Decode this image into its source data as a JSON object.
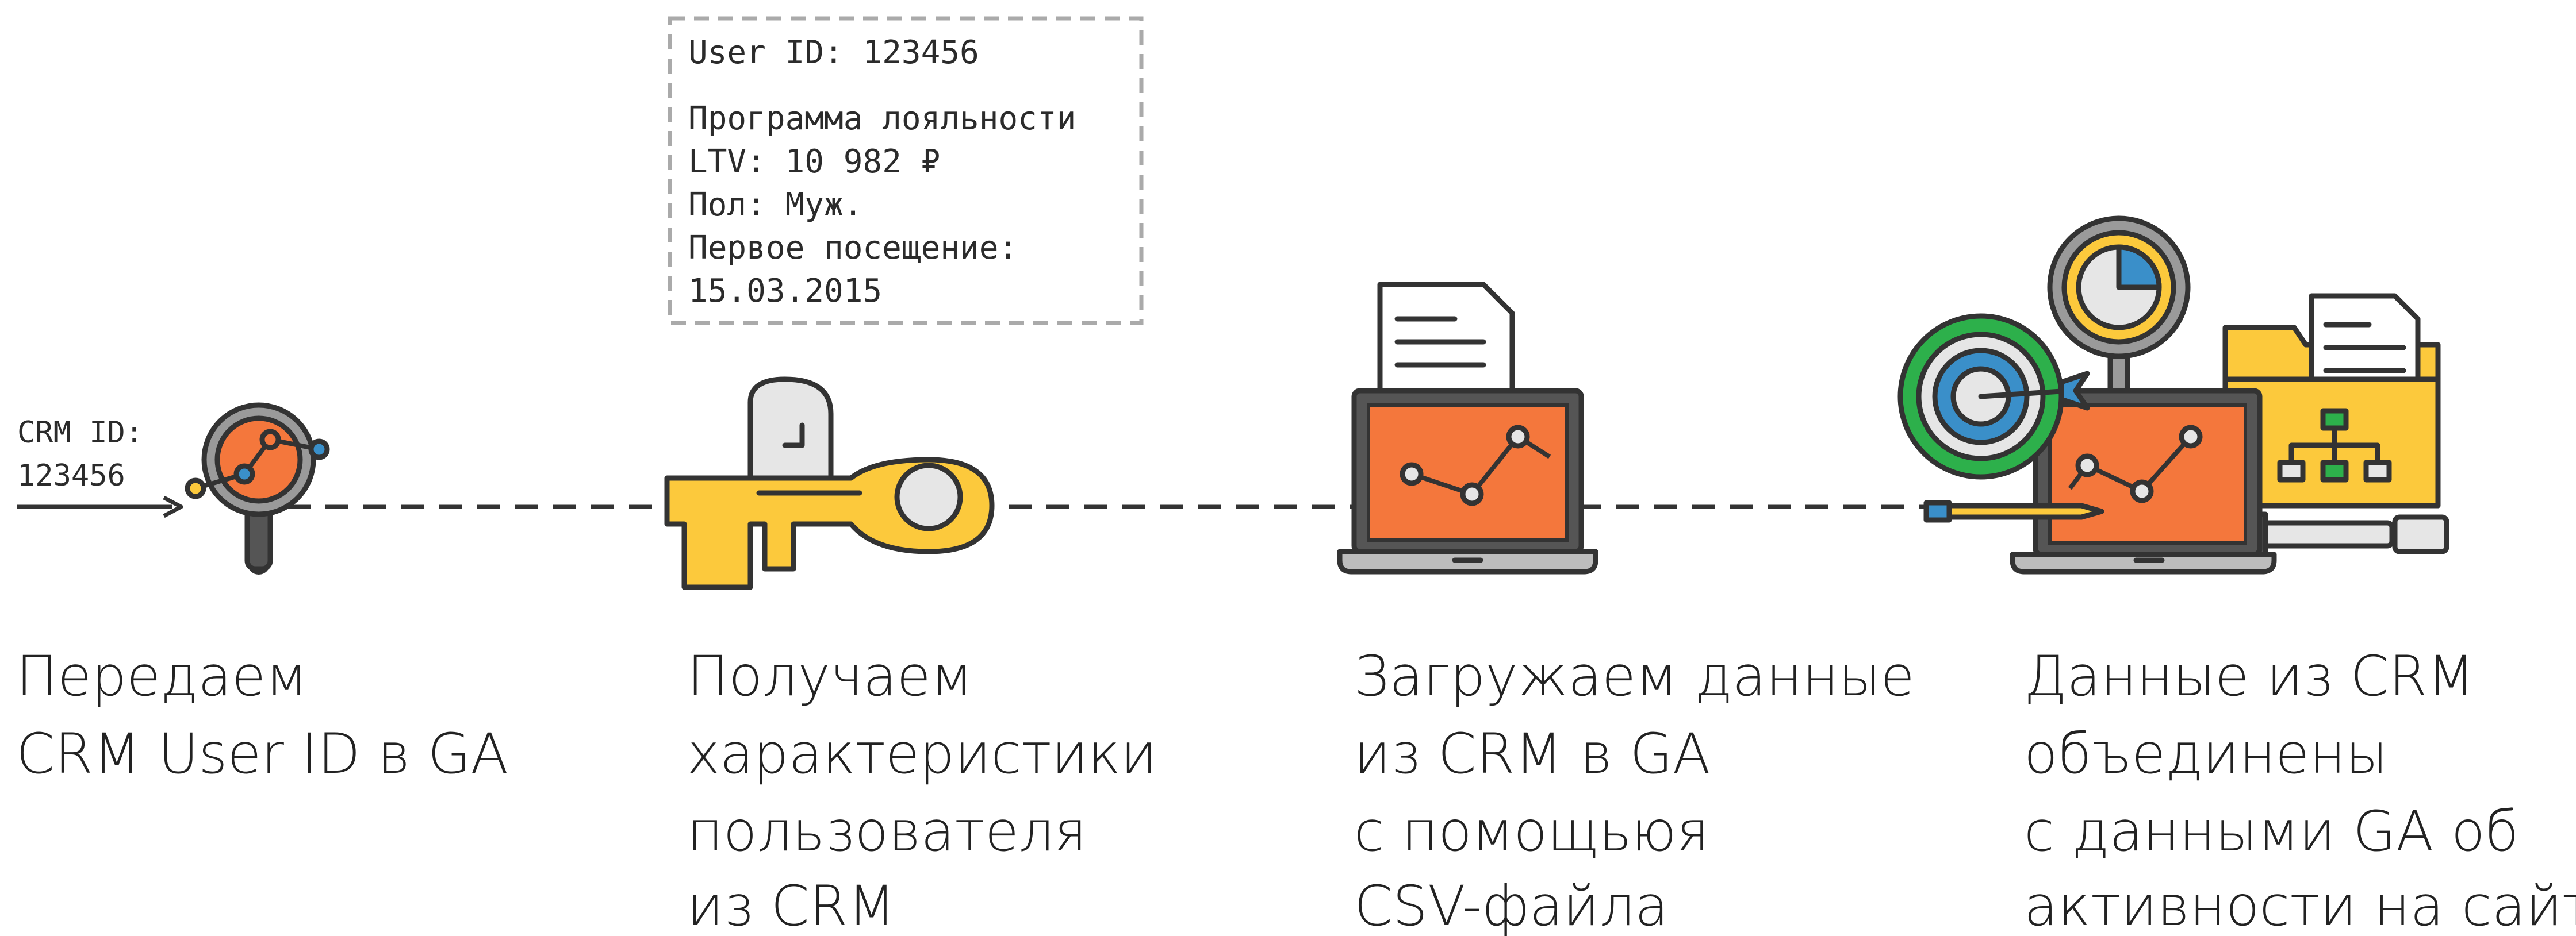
{
  "crm_label": [
    "CRM ID:",
    "123456"
  ],
  "profile_card": {
    "user_id": "User ID: 123456",
    "lines": [
      "Программа лояльности",
      "LTV: 10 982 ₽",
      "Пол: Муж.",
      "Первое посещение:",
      "15.03.2015"
    ]
  },
  "steps": [
    {
      "caption": [
        "Передаем",
        "CRM User ID в GA"
      ]
    },
    {
      "caption": [
        "Получаем",
        "характеристики",
        "пользователя",
        "из CRM"
      ]
    },
    {
      "caption": [
        "Загружаем данные",
        "из CRM в GA",
        "с помощьюя",
        "CSV-файла"
      ]
    },
    {
      "caption": [
        "Данные из CRM",
        "объединены",
        "с данными GA об",
        "активности на сайте"
      ]
    }
  ],
  "icons": [
    "magnifier-chart-icon",
    "key-icon",
    "laptop-document-icon",
    "laptop-target-gauge-folder-icon"
  ],
  "colors": {
    "orange": "#f4773c",
    "yellow": "#fcc93c",
    "blue": "#3a8fc9",
    "green": "#2db04b",
    "ink": "#333333",
    "gray": "#e6e6e6",
    "dash": "#aaaaaa"
  }
}
